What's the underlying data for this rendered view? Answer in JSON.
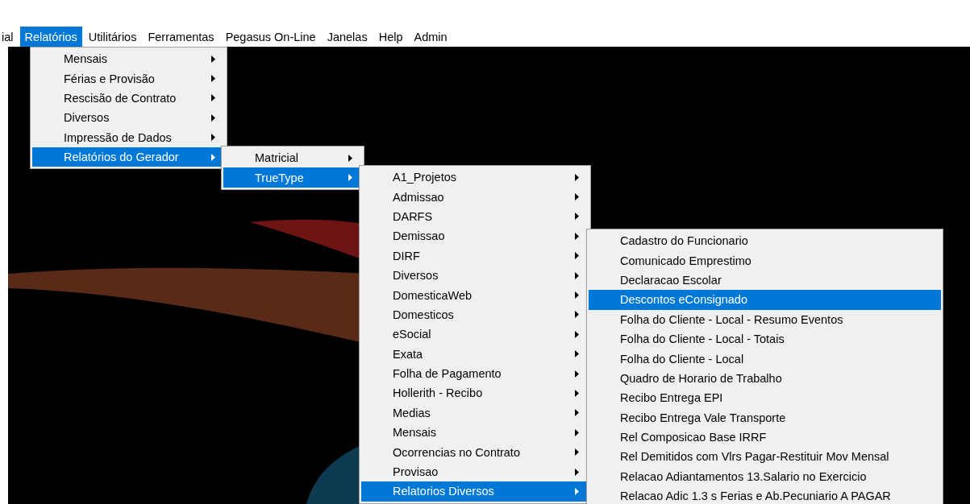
{
  "menubar": {
    "items": [
      {
        "label": "ial",
        "selected": false
      },
      {
        "label": "Relatórios",
        "selected": true
      },
      {
        "label": "Utilitários",
        "selected": false
      },
      {
        "label": "Ferramentas",
        "selected": false
      },
      {
        "label": "Pegasus On-Line",
        "selected": false
      },
      {
        "label": "Janelas",
        "selected": false
      },
      {
        "label": "Help",
        "selected": false
      },
      {
        "label": "Admin",
        "selected": false
      }
    ]
  },
  "menus": [
    {
      "items": [
        {
          "label": "Mensais",
          "submenu": true,
          "selected": false
        },
        {
          "label": "Férias e Provisão",
          "submenu": true,
          "selected": false
        },
        {
          "label": "Rescisão de Contrato",
          "submenu": true,
          "selected": false
        },
        {
          "label": "Diversos",
          "submenu": true,
          "selected": false
        },
        {
          "label": "Impressão de Dados",
          "submenu": true,
          "selected": false
        },
        {
          "label": "Relatórios do Gerador",
          "submenu": true,
          "selected": true
        }
      ]
    },
    {
      "items": [
        {
          "label": "Matricial",
          "submenu": true,
          "selected": false
        },
        {
          "label": "TrueType",
          "submenu": true,
          "selected": true
        }
      ]
    },
    {
      "items": [
        {
          "label": "A1_Projetos",
          "submenu": true,
          "selected": false
        },
        {
          "label": "Admissao",
          "submenu": true,
          "selected": false
        },
        {
          "label": "DARFS",
          "submenu": true,
          "selected": false
        },
        {
          "label": "Demissao",
          "submenu": true,
          "selected": false
        },
        {
          "label": "DIRF",
          "submenu": true,
          "selected": false
        },
        {
          "label": "Diversos",
          "submenu": true,
          "selected": false
        },
        {
          "label": "DomesticaWeb",
          "submenu": true,
          "selected": false
        },
        {
          "label": "Domesticos",
          "submenu": true,
          "selected": false
        },
        {
          "label": "eSocial",
          "submenu": true,
          "selected": false
        },
        {
          "label": "Exata",
          "submenu": true,
          "selected": false
        },
        {
          "label": "Folha de Pagamento",
          "submenu": true,
          "selected": false
        },
        {
          "label": "Hollerith - Recibo",
          "submenu": true,
          "selected": false
        },
        {
          "label": "Medias",
          "submenu": true,
          "selected": false
        },
        {
          "label": "Mensais",
          "submenu": true,
          "selected": false
        },
        {
          "label": "Ocorrencias no Contrato",
          "submenu": true,
          "selected": false
        },
        {
          "label": "Provisao",
          "submenu": true,
          "selected": false
        },
        {
          "label": "Relatorios Diversos",
          "submenu": true,
          "selected": true
        }
      ]
    },
    {
      "items": [
        {
          "label": "Cadastro do Funcionario",
          "submenu": false,
          "selected": false
        },
        {
          "label": "Comunicado Emprestimo",
          "submenu": false,
          "selected": false
        },
        {
          "label": "Declaracao Escolar",
          "submenu": false,
          "selected": false
        },
        {
          "label": "Descontos eConsignado",
          "submenu": false,
          "selected": true
        },
        {
          "label": "Folha do Cliente - Local - Resumo Eventos",
          "submenu": false,
          "selected": false
        },
        {
          "label": "Folha do Cliente - Local - Totais",
          "submenu": false,
          "selected": false
        },
        {
          "label": "Folha do Cliente - Local",
          "submenu": false,
          "selected": false
        },
        {
          "label": "Quadro de Horario de Trabalho",
          "submenu": false,
          "selected": false
        },
        {
          "label": "Recibo Entrega EPI",
          "submenu": false,
          "selected": false
        },
        {
          "label": "Recibo Entrega Vale Transporte",
          "submenu": false,
          "selected": false
        },
        {
          "label": "Rel Composicao Base IRRF",
          "submenu": false,
          "selected": false
        },
        {
          "label": "Rel Demitidos com Vlrs Pagar-Restituir Mov Mensal",
          "submenu": false,
          "selected": false
        },
        {
          "label": "Relacao Adiantamentos 13.Salario no Exercicio",
          "submenu": false,
          "selected": false
        },
        {
          "label": "Relacao Adic 1.3 s Ferias e Ab.Pecuniario A PAGAR",
          "submenu": false,
          "selected": false
        }
      ]
    }
  ]
}
